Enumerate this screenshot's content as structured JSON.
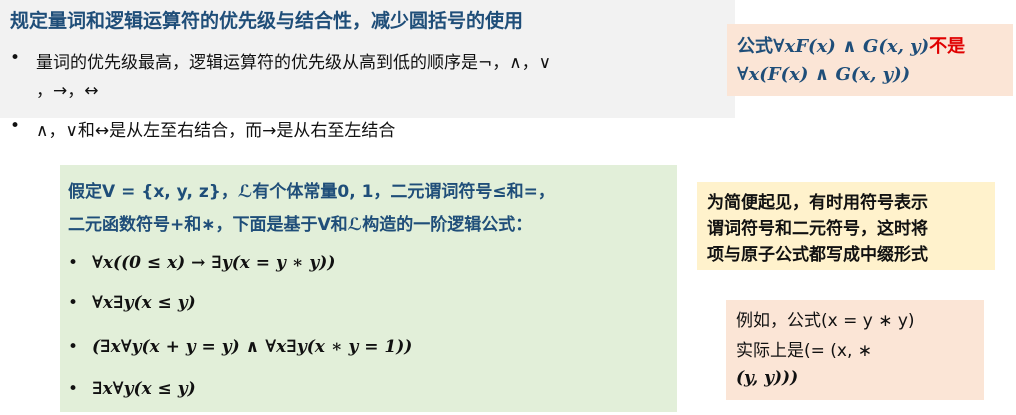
{
  "title": "规定量词和逻辑运算符的优先级与结合性，减少圆括号的使用",
  "bullets": {
    "dot": "•",
    "p1_line1": "量词的优先级最高，逻辑运算符的优先级从高到低的顺序是¬，∧，∨",
    "p1_line2": "，→，↔",
    "p2": "∧，∨和↔是从左至右结合，而→是从右至左结合"
  },
  "formula_box": {
    "label": "公式",
    "formula1": "∀xF(x) ∧ G(x, y)",
    "not_label": "不是",
    "formula2": "∀x(F(x) ∧ G(x, y))"
  },
  "green": {
    "line1": "假定V = {x, y, z}，ℒ有个体常量0, 1，二元谓词符号≤和=，",
    "line2": "二元函数符号+和∗，下面是基于V和ℒ构造的一阶逻辑公式：",
    "formulas": [
      "∀x((0 ≤ x) → ∃y(x = y ∗ y))",
      "∀x∃y(x ≤ y)",
      "(∃x∀y(x + y = y) ∧ ∀x∃y(x ∗ y = 1))",
      "∃x∀y(x ≤ y)"
    ]
  },
  "note": {
    "line1": "为简便起见，有时用符号表示",
    "line2": "谓词符号和二元符号，这时将",
    "line3": "项与原子公式都写成中缀形式"
  },
  "example": {
    "line1": "例如，公式(x = y ∗ y)",
    "line2": "实际上是(= (x, ∗",
    "line3": "(y, y)))"
  },
  "colors": {
    "title": "#1f4e79",
    "grey_block": "#f2f2f2",
    "green_block": "#e2efd9",
    "peach_box": "#fbe5d6",
    "yellow_box": "#fff2cc",
    "emphasis_red": "#e00000"
  }
}
